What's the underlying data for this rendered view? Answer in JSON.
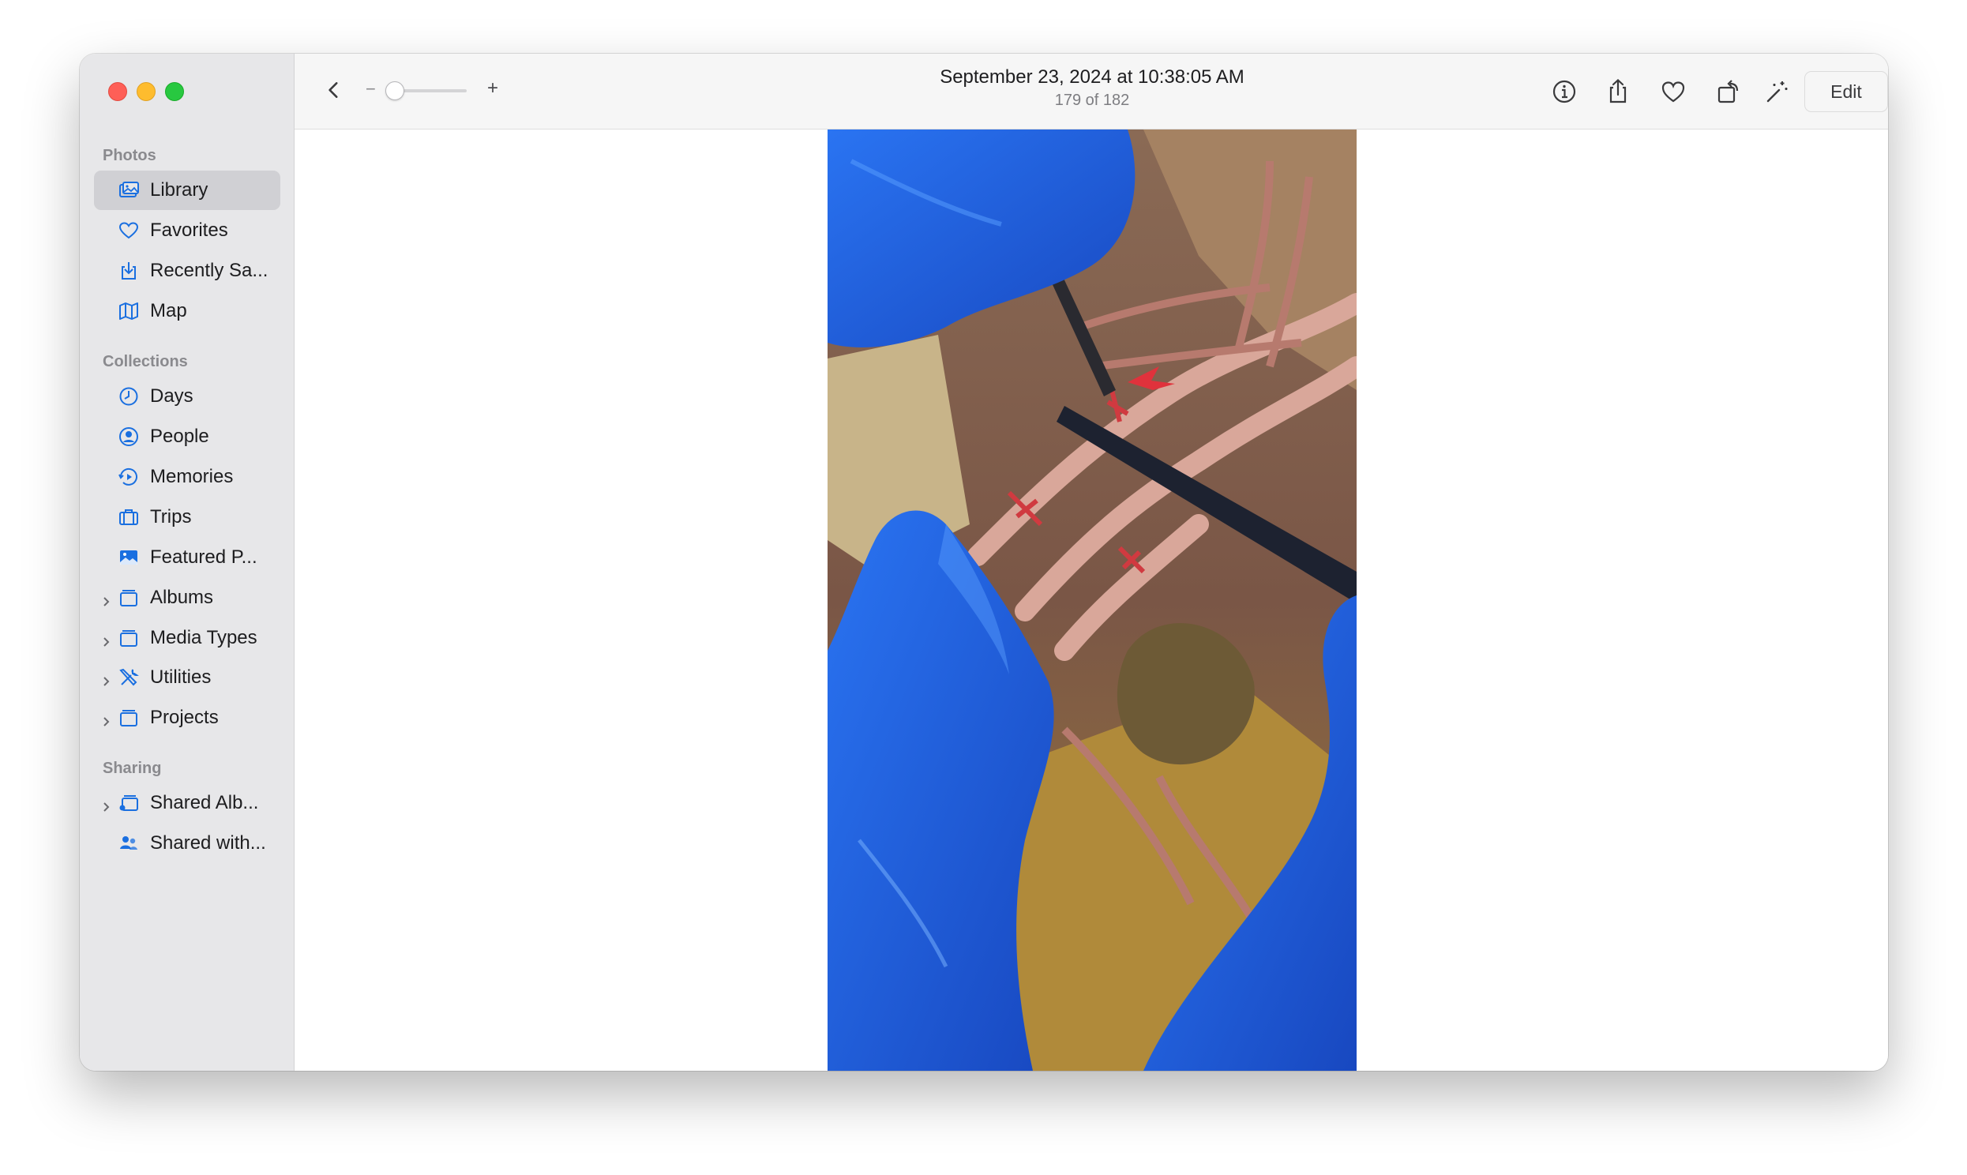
{
  "sidebar": {
    "sections": [
      {
        "header": "Photos",
        "items": [
          {
            "label": "Library",
            "icon": "library-icon",
            "selected": true
          },
          {
            "label": "Favorites",
            "icon": "heart-icon"
          },
          {
            "label": "Recently Sa...",
            "icon": "recently-saved-icon"
          },
          {
            "label": "Map",
            "icon": "map-icon"
          }
        ]
      },
      {
        "header": "Collections",
        "items": [
          {
            "label": "Days",
            "icon": "clock-icon"
          },
          {
            "label": "People",
            "icon": "person-icon"
          },
          {
            "label": "Memories",
            "icon": "memories-icon"
          },
          {
            "label": "Trips",
            "icon": "suitcase-icon"
          },
          {
            "label": "Featured P...",
            "icon": "photo-icon"
          },
          {
            "label": "Albums",
            "icon": "album-stack-icon",
            "expandable": true
          },
          {
            "label": "Media Types",
            "icon": "album-stack-icon",
            "expandable": true
          },
          {
            "label": "Utilities",
            "icon": "tools-icon",
            "expandable": true
          },
          {
            "label": "Projects",
            "icon": "album-stack-icon",
            "expandable": true
          }
        ]
      },
      {
        "header": "Sharing",
        "items": [
          {
            "label": "Shared Alb...",
            "icon": "shared-album-icon",
            "expandable": true
          },
          {
            "label": "Shared with...",
            "icon": "shared-people-icon"
          }
        ]
      }
    ]
  },
  "toolbar": {
    "title": "September 23, 2024 at 10:38:05 AM",
    "subtitle": "179 of 182",
    "zoom_minus": "−",
    "zoom_plus": "+",
    "zoom_level": 0.0,
    "edit_label": "Edit",
    "icons": [
      "back-chevron-icon",
      "info-icon",
      "share-icon",
      "heart-icon",
      "rotate-icon",
      "enhance-wand-icon"
    ]
  },
  "colors": {
    "accent": "#1a6fe0",
    "sidebar_bg": "#e7e7e9",
    "selected_bg": "#d0d0d4",
    "glove_blue": "#1e62e6"
  }
}
